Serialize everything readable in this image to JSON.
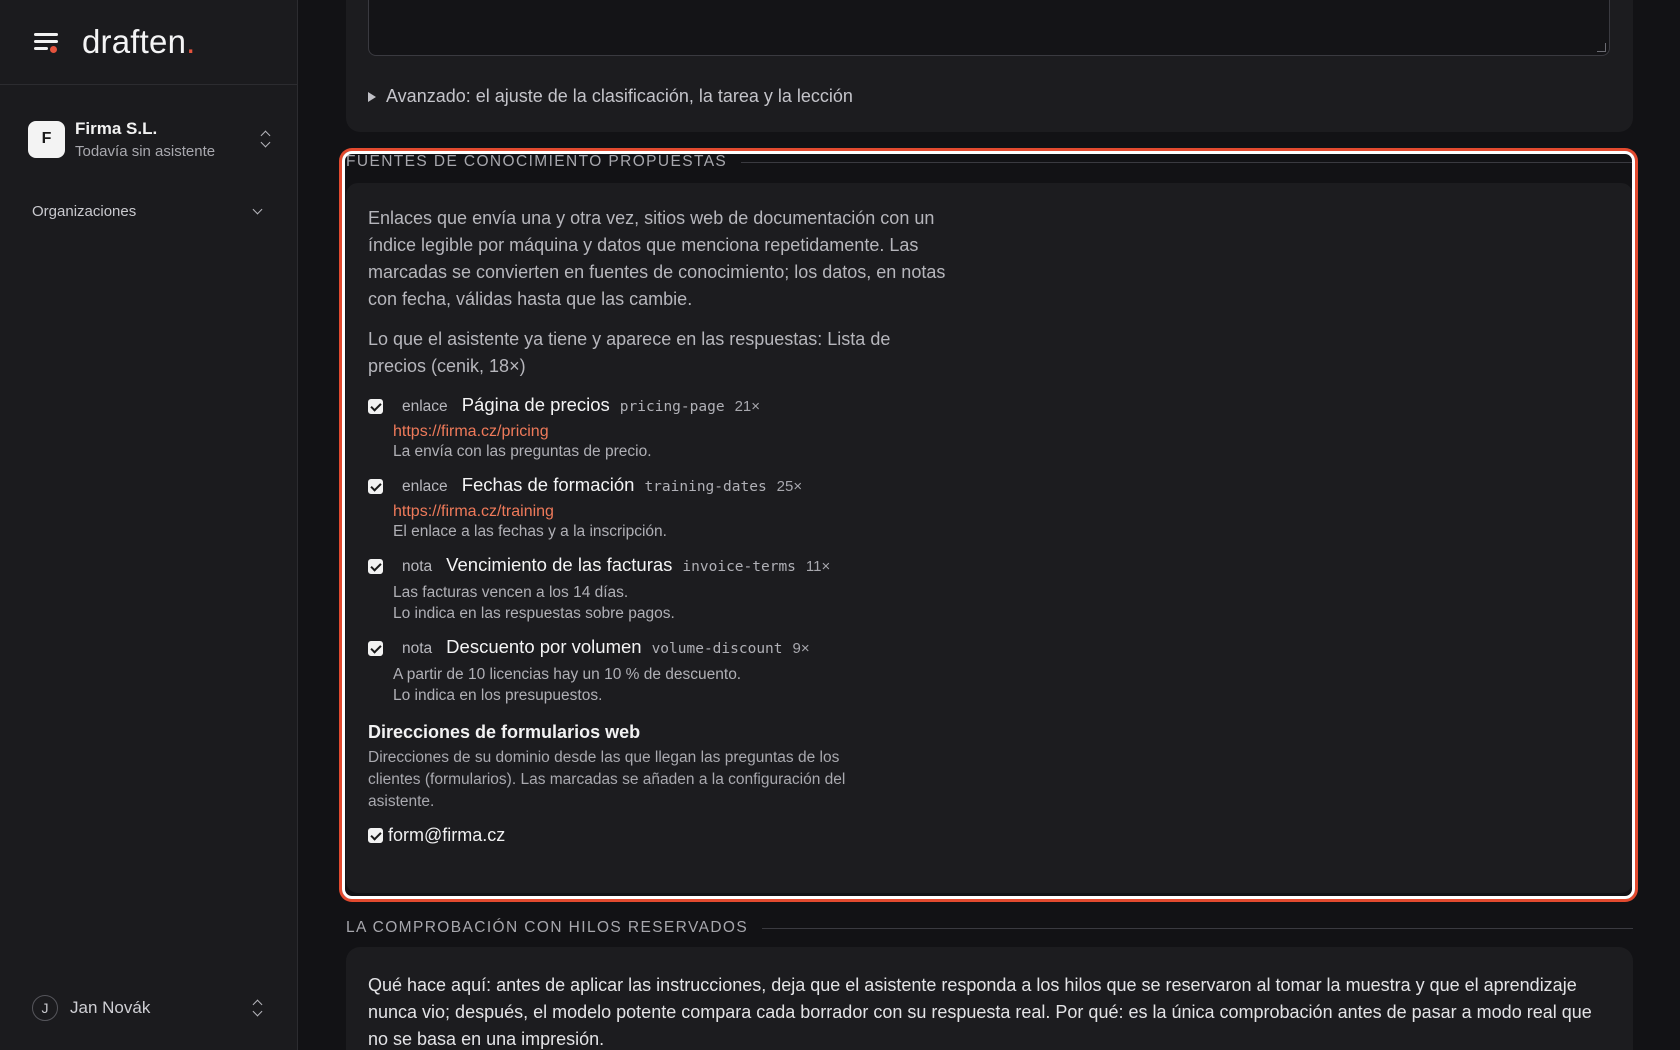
{
  "brand": {
    "name": "draften",
    "accent": "."
  },
  "sidebar": {
    "org": {
      "initial": "F",
      "name": "Firma S.L.",
      "subtitle": "Todavía sin asistente"
    },
    "section": "Organizaciones",
    "user": {
      "initial": "J",
      "name": "Jan Novák"
    }
  },
  "advanced": {
    "label": "Avanzado: el ajuste de la clasificación, la tarea y la lección"
  },
  "knowledge": {
    "title": "FUENTES DE CONOCIMIENTO PROPUESTAS",
    "intro": "Enlaces que envía una y otra vez, sitios web de documentación con un índice legible por máquina y datos que menciona repetidamente. Las marcadas se convierten en fuentes de conocimiento; los datos, en notas con fecha, válidas hasta que las cambie.",
    "have": "Lo que el asistente ya tiene y aparece en las respuestas: Lista de precios (cenik, 18×)",
    "sources": [
      {
        "kind": "enlace",
        "title": "Página de precios",
        "slug": "pricing-page",
        "count": "21×",
        "url": "https://firma.cz/pricing",
        "desc": [
          "La envía con las preguntas de precio."
        ],
        "checked": true
      },
      {
        "kind": "enlace",
        "title": "Fechas de formación",
        "slug": "training-dates",
        "count": "25×",
        "url": "https://firma.cz/training",
        "desc": [
          "El enlace a las fechas y a la inscripción."
        ],
        "checked": true
      },
      {
        "kind": "nota",
        "title": "Vencimiento de las facturas",
        "slug": "invoice-terms",
        "count": "11×",
        "url": "",
        "desc": [
          "Las facturas vencen a los 14 días.",
          "Lo indica en las respuestas sobre pagos."
        ],
        "checked": true
      },
      {
        "kind": "nota",
        "title": "Descuento por volumen",
        "slug": "volume-discount",
        "count": "9×",
        "url": "",
        "desc": [
          "A partir de 10 licencias hay un 10 % de descuento.",
          "Lo indica en los presupuestos."
        ],
        "checked": true
      }
    ],
    "forms": {
      "title": "Direcciones de formularios web",
      "desc": "Direcciones de su dominio desde las que llegan las preguntas de los clientes (formularios). Las marcadas se añaden a la configuración del asistente.",
      "address": "form@firma.cz",
      "checked": true
    }
  },
  "check": {
    "title": "LA COMPROBACIÓN CON HILOS RESERVADOS",
    "text": "Qué hace aquí: antes de aplicar las instrucciones, deja que el asistente responda a los hilos que se reservaron al tomar la muestra y que el aprendizaje nunca vio; después, el modelo potente compara cada borrador con su respuesta real. Por qué: es la única comprobación antes de pasar a modo real que no se basa en una impresión."
  },
  "colors": {
    "accent": "#e5533d",
    "link": "#ef7a5a",
    "highlight": "#e24a2f"
  }
}
